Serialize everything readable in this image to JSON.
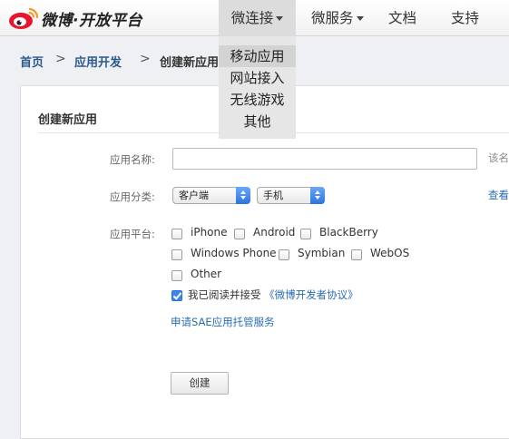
{
  "brand": {
    "logo_text": "微博·开放平台"
  },
  "nav": {
    "items": [
      {
        "label": "微连接",
        "has_caret": true
      },
      {
        "label": "微服务",
        "has_caret": true
      },
      {
        "label": "文档"
      },
      {
        "label": "支持"
      }
    ],
    "dropdown": [
      "移动应用",
      "网站接入",
      "无线游戏",
      "其他"
    ]
  },
  "breadcrumb": {
    "items": [
      "首页",
      "应用开发",
      "创建新应用"
    ],
    "separator": ">"
  },
  "form": {
    "section_title": "创建新应用",
    "name_label": "应用名称:",
    "name_value": "",
    "name_hint": "该名",
    "category_label": "应用分类:",
    "category_primary": "客户端",
    "category_secondary": "手机",
    "category_link": "查看",
    "platform_label": "应用平台:",
    "platforms": [
      {
        "label": "iPhone",
        "checked": false
      },
      {
        "label": "Android",
        "checked": false
      },
      {
        "label": "BlackBerry",
        "checked": false
      },
      {
        "label": "Windows Phone",
        "checked": false
      },
      {
        "label": "Symbian",
        "checked": false
      },
      {
        "label": "WebOS",
        "checked": false
      },
      {
        "label": "Other",
        "checked": false
      }
    ],
    "agree_text": "我已阅读并接受",
    "agree_link": "《微博开发者协议》",
    "agree_checked": true,
    "sae_link": "申请SAE应用托管服务",
    "submit_label": "创建"
  },
  "colors": {
    "link": "#2a6cb0",
    "select_arrow": "#2b74e0",
    "checkbox_checked": "#3b86f0"
  }
}
